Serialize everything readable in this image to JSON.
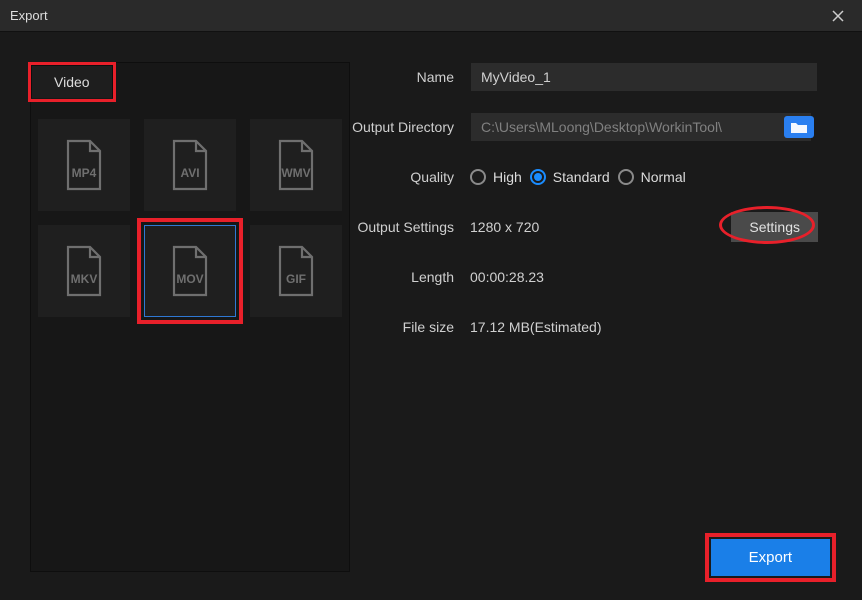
{
  "window": {
    "title": "Export"
  },
  "tabs": {
    "video": "Video"
  },
  "formats": {
    "row1": [
      "MP4",
      "AVI",
      "WMV"
    ],
    "row2": [
      "MKV",
      "MOV",
      "GIF"
    ],
    "selected": "MOV"
  },
  "form": {
    "name_label": "Name",
    "name_value": "MyVideo_1",
    "dir_label": "Output Directory",
    "dir_value": "C:\\Users\\MLoong\\Desktop\\WorkinTool\\",
    "quality_label": "Quality",
    "quality_options": {
      "high": "High",
      "standard": "Standard",
      "normal": "Normal"
    },
    "quality_selected": "standard",
    "out_settings_label": "Output Settings",
    "out_settings_value": "1280 x 720",
    "settings_btn": "Settings",
    "length_label": "Length",
    "length_value": "00:00:28.23",
    "filesize_label": "File size",
    "filesize_value": "17.12 MB(Estimated)"
  },
  "export_btn": "Export"
}
